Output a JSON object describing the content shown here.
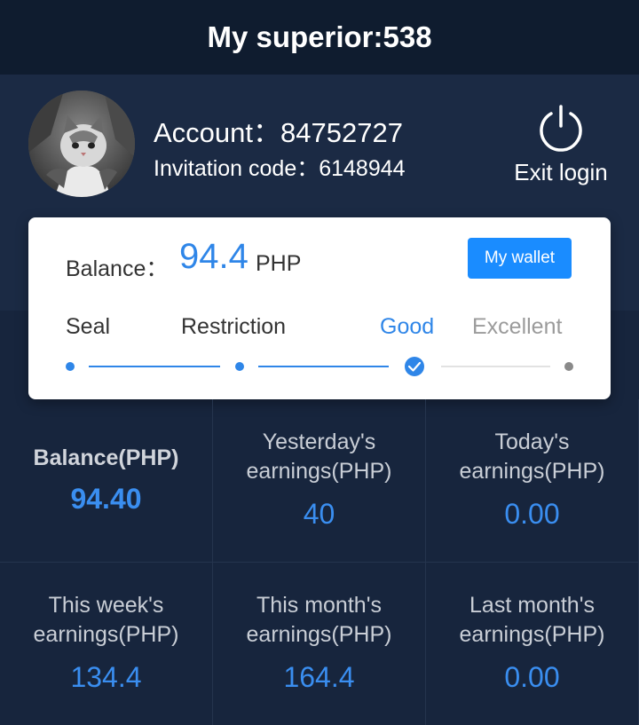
{
  "header": {
    "title": "My superior:538"
  },
  "profile": {
    "account_label": "Account：",
    "account_value": "84752727",
    "invite_label": "Invitation code：",
    "invite_value": "6148944",
    "exit_icon": "power-icon",
    "exit_label": "Exit login"
  },
  "card": {
    "balance_label": "Balance：",
    "balance_value": "94.4",
    "balance_unit": "PHP",
    "wallet_button": "My wallet",
    "levels": [
      "Seal",
      "Restriction",
      "Good",
      "Excellent"
    ],
    "current_level": "Good"
  },
  "stats": [
    {
      "label": "Balance(PHP)",
      "value": "94.40"
    },
    {
      "label": "Yesterday's earnings(PHP)",
      "value": "40"
    },
    {
      "label": "Today's earnings(PHP)",
      "value": "0.00"
    },
    {
      "label": "This week's earnings(PHP)",
      "value": "134.4"
    },
    {
      "label": "This month's earnings(PHP)",
      "value": "164.4"
    },
    {
      "label": "Last month's earnings(PHP)",
      "value": "0.00"
    }
  ],
  "colors": {
    "accent": "#2f86e8",
    "button": "#1a8cff",
    "header_bg": "#0f1c2f",
    "profile_bg": "#1b2a44",
    "grid_bg": "#17253d"
  }
}
